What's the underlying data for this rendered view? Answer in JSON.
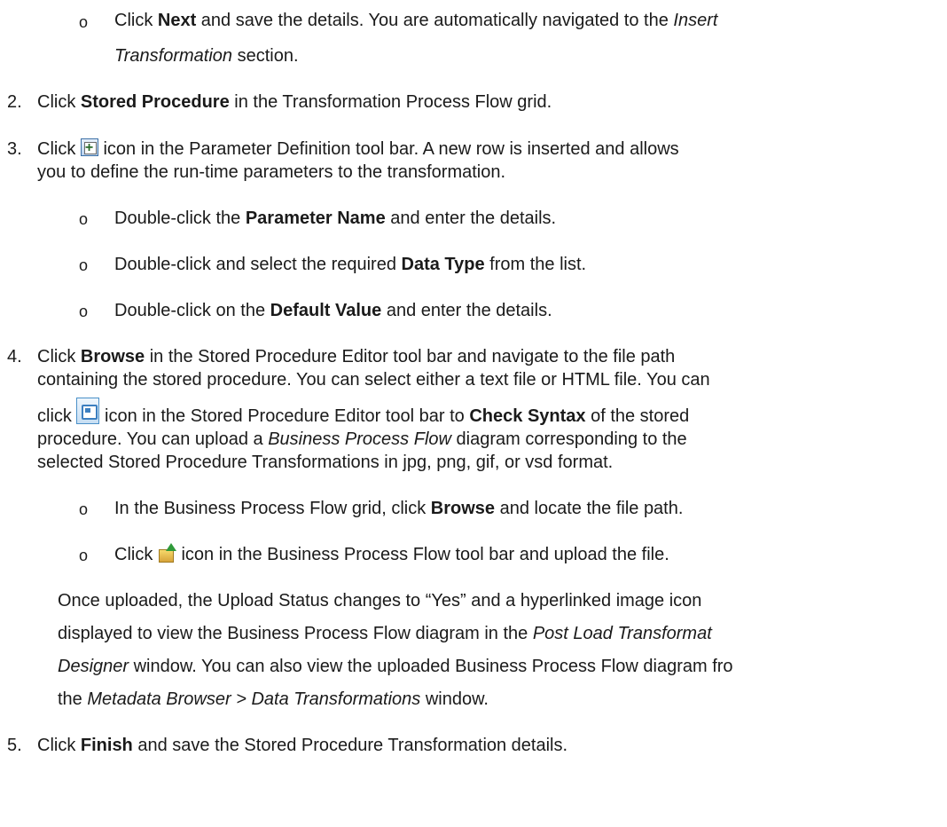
{
  "step1": {
    "bullet": "o",
    "pre": "Click ",
    "bold": "Next",
    "mid": " and save the details. You are automatically navigated to the ",
    "italic_a": "Insert",
    "italic_b": "Transformation",
    "post": " section."
  },
  "step2": {
    "num": "2.",
    "pre": "Click ",
    "bold": "Stored Procedure",
    "post": " in the Transformation Process Flow grid."
  },
  "step3": {
    "num": "3.",
    "pre": "Click ",
    "icon": "insert-row-icon",
    "post_a": " icon in the Parameter Definition tool bar. A new row is inserted and allows",
    "post_b": "you to define the run-time parameters to the transformation.",
    "sub": [
      {
        "bullet": "o",
        "pre": "Double-click the ",
        "bold": "Parameter Name",
        "post": " and enter the details."
      },
      {
        "bullet": "o",
        "pre": "Double-click and select the required ",
        "bold": "Data Type",
        "post": " from the list."
      },
      {
        "bullet": "o",
        "pre": "Double-click on the ",
        "bold": "Default Value",
        "post": " and enter the details."
      }
    ]
  },
  "step4": {
    "num": "4.",
    "l1_pre": "Click ",
    "l1_bold": "Browse",
    "l1_post": " in the Stored Procedure Editor tool bar and navigate to the file path",
    "l2": "containing the stored procedure. You can select either a text file or HTML file. You can",
    "l3_pre": "click ",
    "icon": "check-syntax-icon",
    "l3_mid": " icon in the Stored Procedure Editor tool bar to ",
    "l3_bold": "Check Syntax",
    "l3_post": " of the stored",
    "l4_pre": "procedure. You can upload a ",
    "l4_italic": "Business Process Flow",
    "l4_post": " diagram corresponding to the",
    "l5": "selected Stored Procedure Transformations in jpg, png, gif, or vsd format.",
    "sub": [
      {
        "bullet": "o",
        "pre": "In the Business Process Flow grid, click ",
        "bold": "Browse",
        "post": " and locate the file path."
      },
      {
        "bullet": "o",
        "pre": "Click ",
        "icon": "upload-icon",
        "post": " icon in the Business Process Flow tool bar and upload the file."
      }
    ],
    "note_l1": "Once uploaded, the Upload Status changes to “Yes” and a hyperlinked image icon",
    "note_l2_pre": "displayed to view the Business Process Flow diagram in the ",
    "note_l2_italic": "Post Load Transformat",
    "note_l3_italic": "Designer",
    "note_l3_post": " window. You can also view the uploaded Business Process Flow diagram fro",
    "note_l4_pre": "the ",
    "note_l4_italic": "Metadata Browser > Data Transformations",
    "note_l4_post": " window."
  },
  "step5": {
    "num": "5.",
    "pre": "Click ",
    "bold": "Finish",
    "post": " and save the Stored Procedure Transformation details."
  }
}
